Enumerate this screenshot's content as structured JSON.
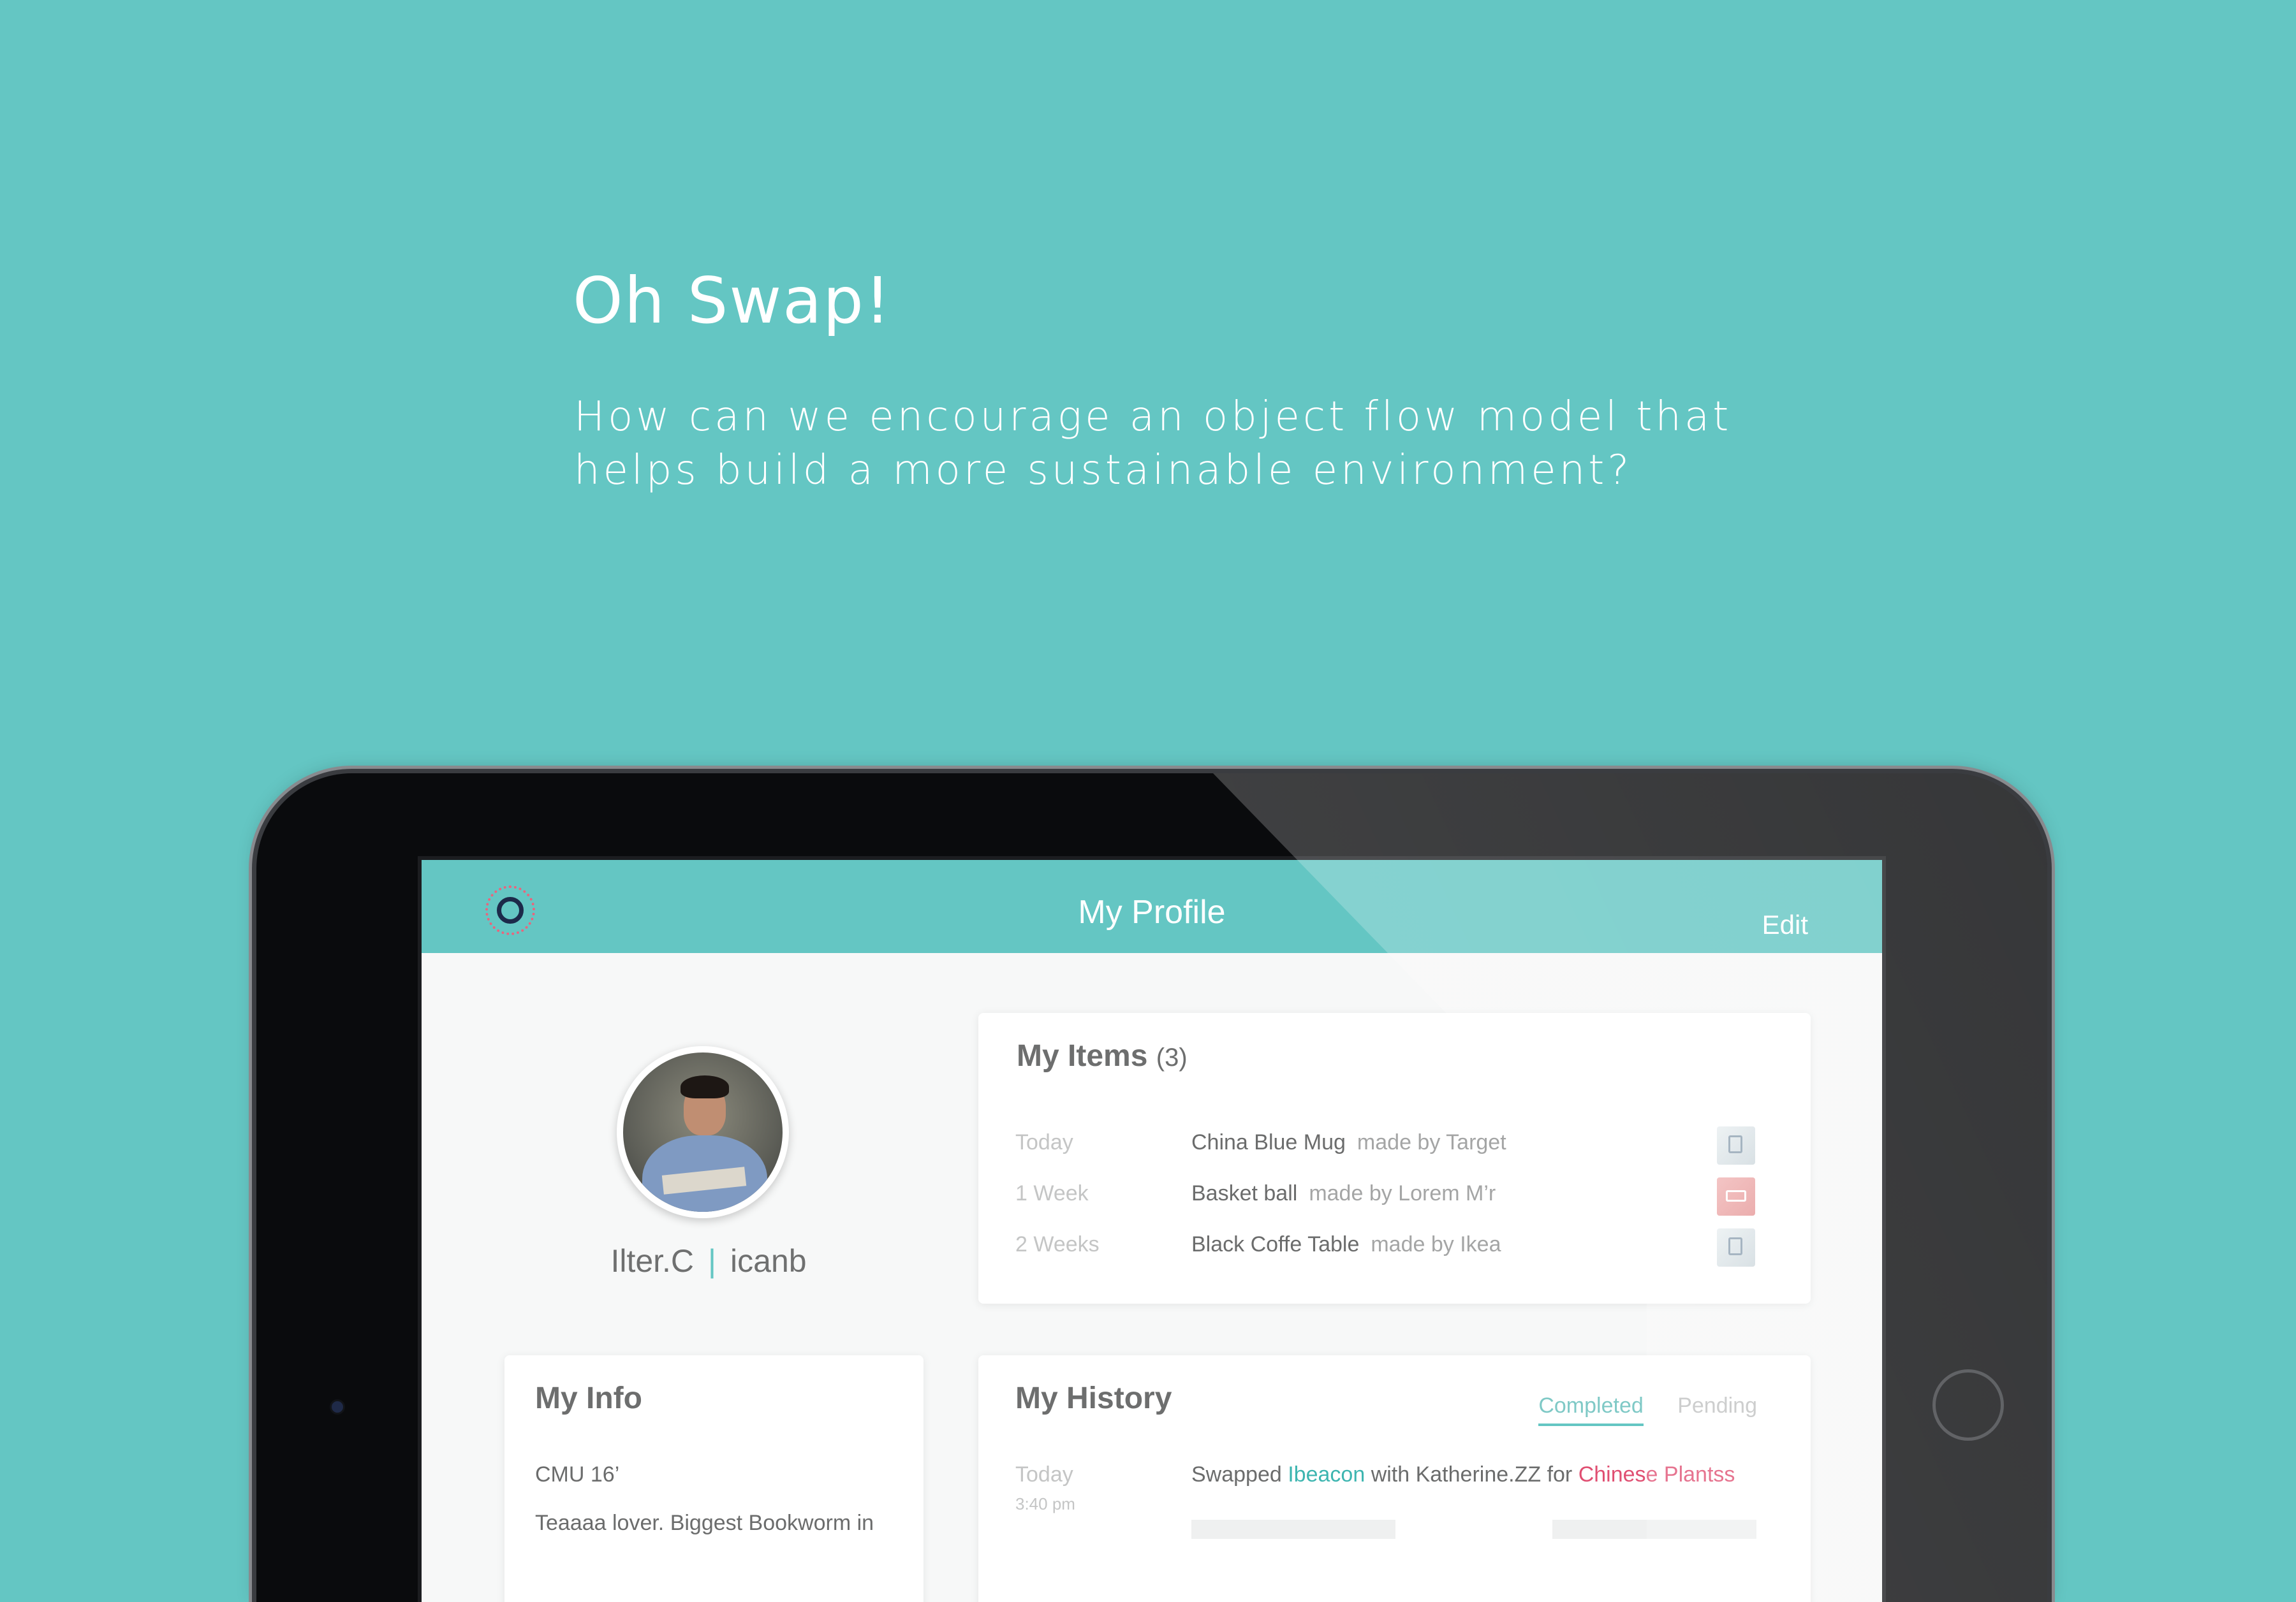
{
  "hero": {
    "title": "Oh Swap!",
    "subtitle_line1": "How can we encourage an object flow model that",
    "subtitle_line2": "helps build a more sustainable environment?"
  },
  "header": {
    "title": "My Profile",
    "edit_label": "Edit"
  },
  "profile": {
    "name": "Ilter.C",
    "separator": "|",
    "username": "icanb"
  },
  "my_items": {
    "title": "My Items",
    "count": "(3)",
    "rows": [
      {
        "time": "Today",
        "name": "China Blue Mug",
        "maker": "made by Target",
        "thumb_icon": "mug-thumbnail"
      },
      {
        "time": "1 Week",
        "name": "Basket ball",
        "maker": "made by Lorem M’r",
        "thumb_icon": "basketball-thumbnail"
      },
      {
        "time": "2 Weeks",
        "name": "Black Coffe Table",
        "maker": "made by Ikea",
        "thumb_icon": "table-thumbnail"
      }
    ]
  },
  "my_info": {
    "title": "My Info",
    "school": "CMU 16’",
    "bio": "Teaaaa lover. Biggest Bookworm in"
  },
  "my_history": {
    "title": "My History",
    "tabs": {
      "completed": "Completed",
      "pending": "Pending"
    },
    "entry": {
      "time": "Today",
      "clock": "3:40 pm",
      "prefix": "Swapped",
      "item": "Ibeacon",
      "middle": "with Katherine.ZZ for",
      "other_item": "Chinese Plantss"
    }
  },
  "colors": {
    "background": "#64c6c3",
    "accent": "#64c6c3",
    "highlight": "#e04f72"
  }
}
